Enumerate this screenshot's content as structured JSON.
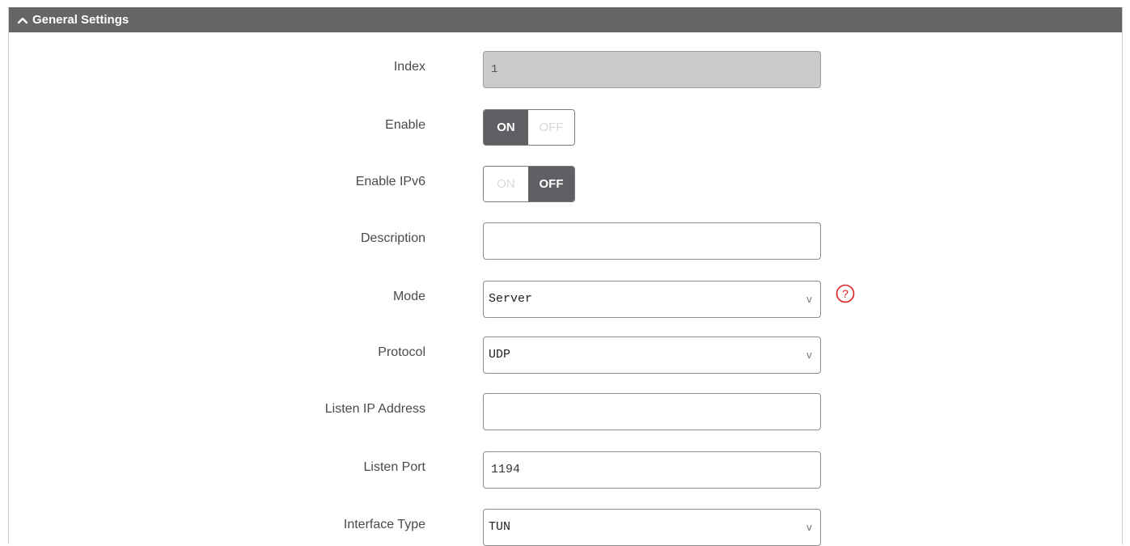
{
  "section": {
    "title": "General Settings",
    "collapse_icon": "chevron-up-icon"
  },
  "fields": {
    "index": {
      "label": "Index",
      "value": "1"
    },
    "enable": {
      "label": "Enable",
      "on_label": "ON",
      "off_label": "OFF",
      "state": "on"
    },
    "enable_ipv6": {
      "label": "Enable IPv6",
      "on_label": "ON",
      "off_label": "OFF",
      "state": "off"
    },
    "description": {
      "label": "Description",
      "value": ""
    },
    "mode": {
      "label": "Mode",
      "value": "Server",
      "arrow": "v",
      "help_icon": "question-circle-icon",
      "help_glyph": "?"
    },
    "protocol": {
      "label": "Protocol",
      "value": "UDP",
      "arrow": "v"
    },
    "listen_ip": {
      "label": "Listen IP Address",
      "value": ""
    },
    "listen_port": {
      "label": "Listen Port",
      "value": "1194"
    },
    "interface_type": {
      "label": "Interface Type",
      "value": "TUN",
      "arrow": "v"
    }
  },
  "colors": {
    "header_bg": "#646567",
    "toggle_active": "#5f6064",
    "help_red": "#e02020",
    "readonly_bg": "#cbcbcb"
  }
}
